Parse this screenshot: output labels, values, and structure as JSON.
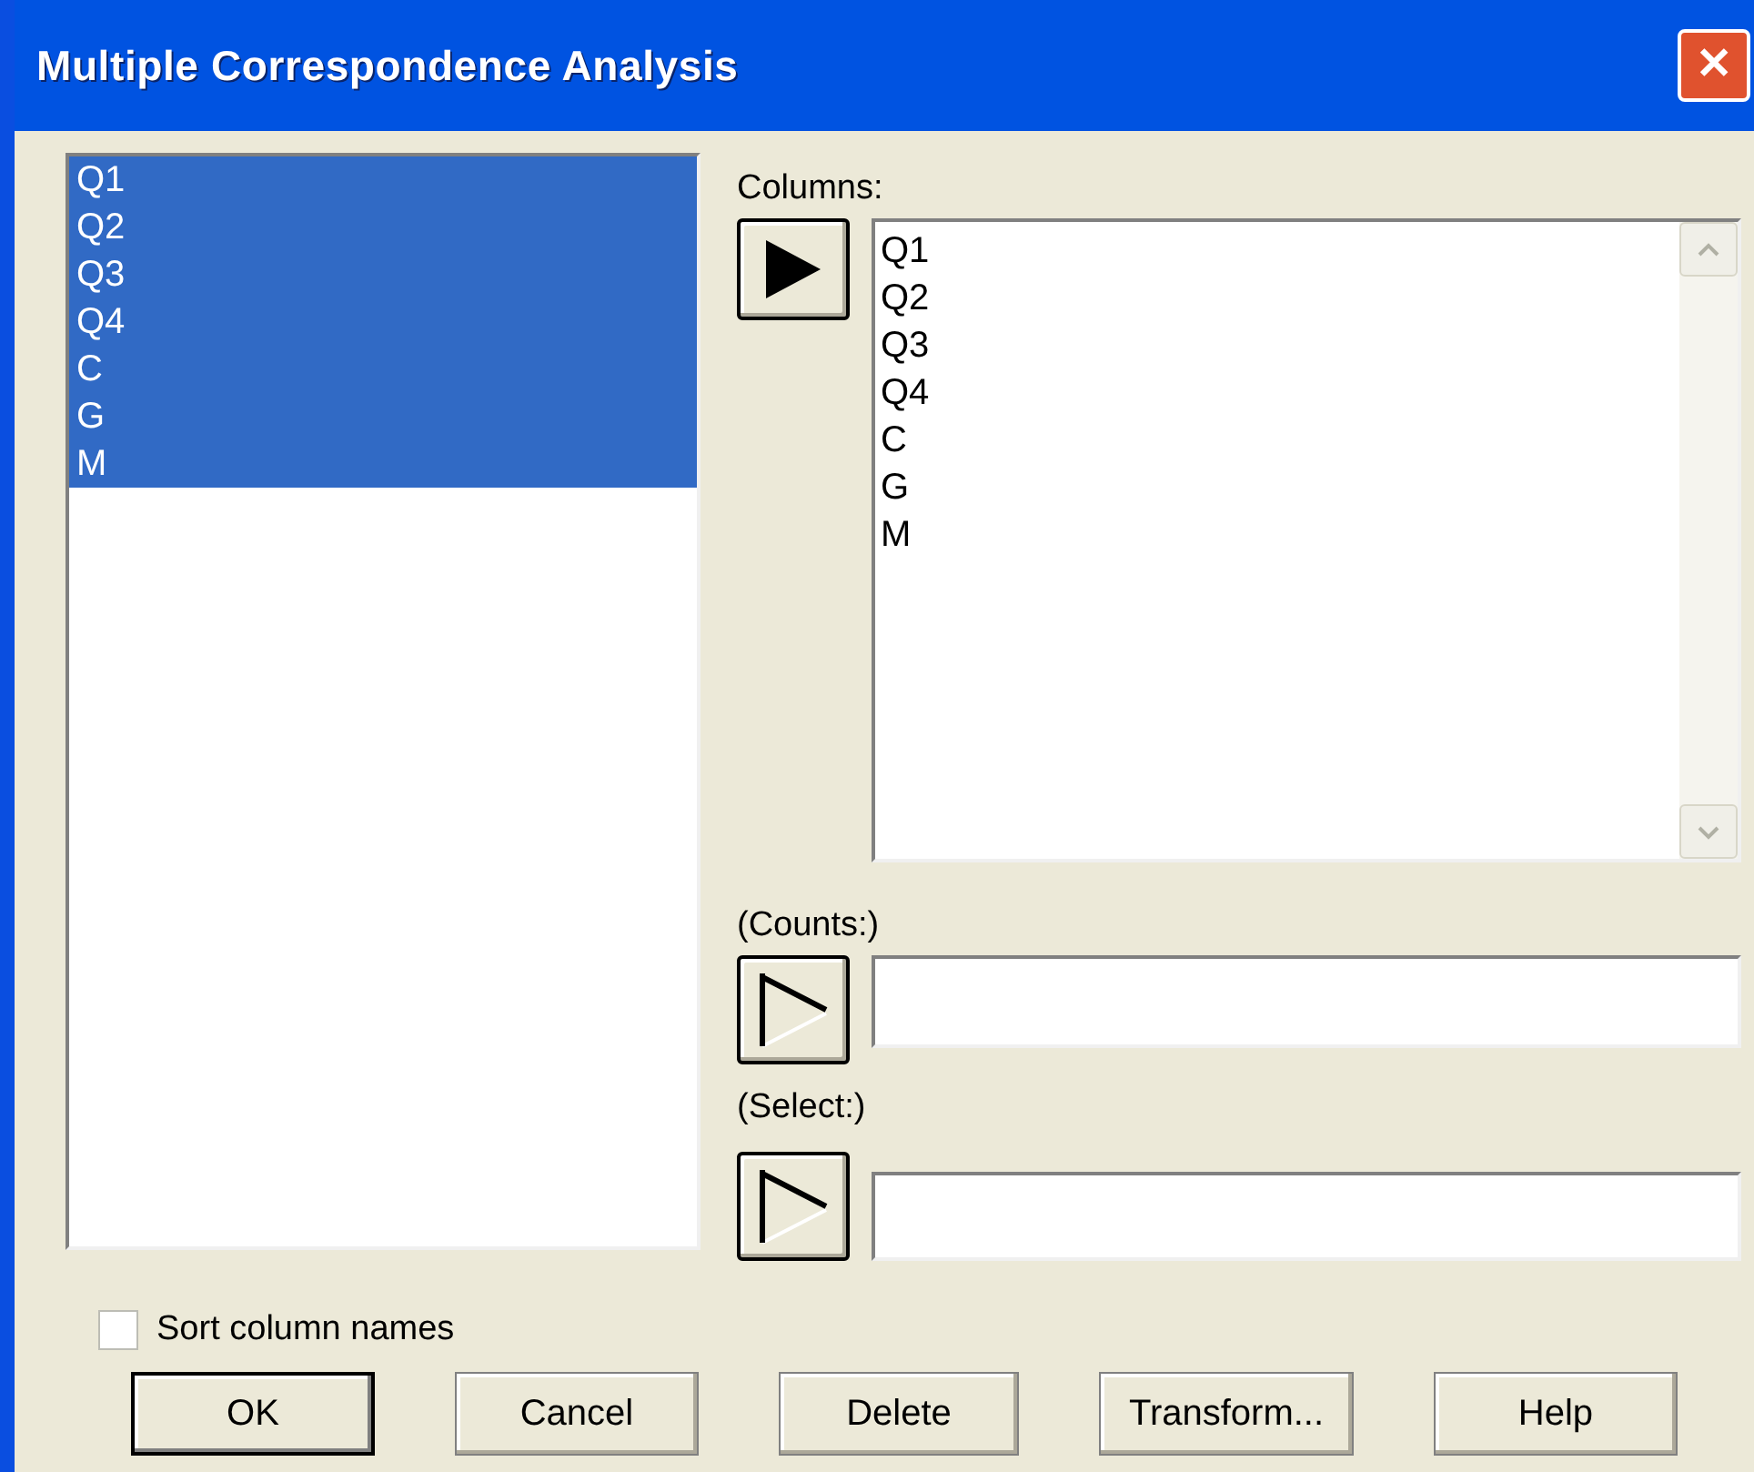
{
  "window": {
    "title": "Multiple Correspondence Analysis",
    "close": "✕"
  },
  "variables": [
    {
      "label": "Q1",
      "selected": true
    },
    {
      "label": "Q2",
      "selected": true
    },
    {
      "label": "Q3",
      "selected": true
    },
    {
      "label": "Q4",
      "selected": true
    },
    {
      "label": "C",
      "selected": true
    },
    {
      "label": "G",
      "selected": true
    },
    {
      "label": "M",
      "selected": true
    }
  ],
  "columns": {
    "label": "Columns:",
    "arrow_enabled": true,
    "items": [
      "Q1",
      "Q2",
      "Q3",
      "Q4",
      "C",
      "G",
      "M"
    ]
  },
  "counts": {
    "label": "(Counts:)",
    "arrow_enabled": false
  },
  "select": {
    "label": "(Select:)",
    "arrow_enabled": false
  },
  "sort_column_names": {
    "label": "Sort column names",
    "checked": false
  },
  "buttons": [
    {
      "label": "OK",
      "default": true
    },
    {
      "label": "Cancel",
      "default": false
    },
    {
      "label": "Delete",
      "default": false
    },
    {
      "label": "Transform...",
      "default": false
    },
    {
      "label": "Help",
      "default": false
    }
  ]
}
